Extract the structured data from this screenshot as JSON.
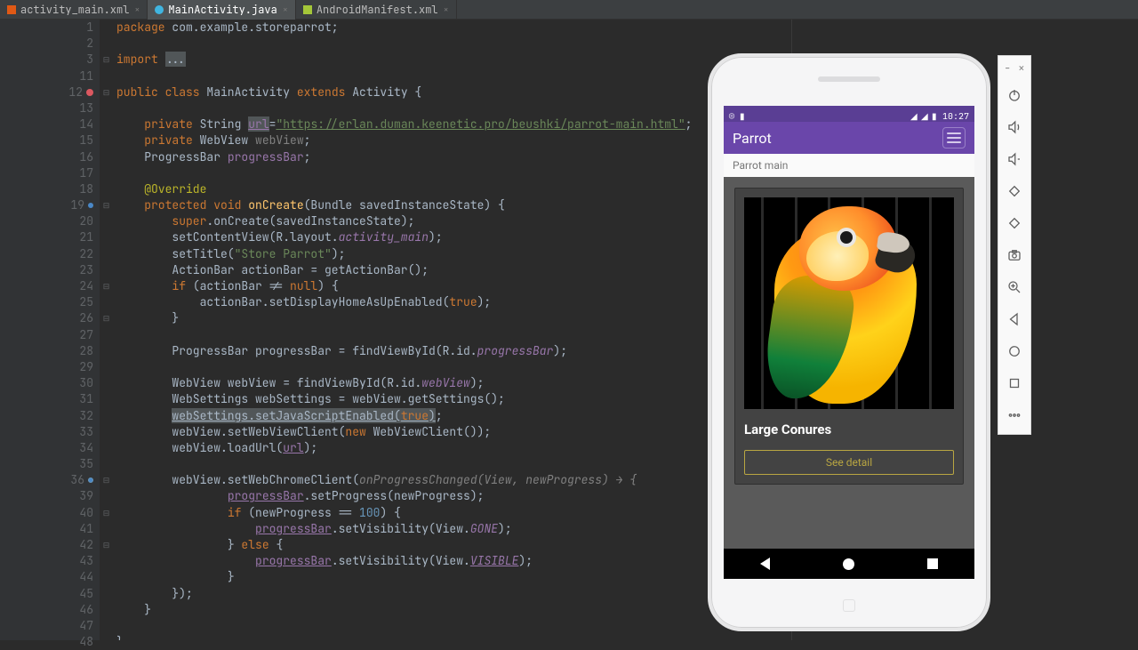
{
  "tabs": [
    {
      "label": "activity_main.xml",
      "icon": "xml",
      "active": false
    },
    {
      "label": "MainActivity.java",
      "icon": "java",
      "active": true
    },
    {
      "label": "AndroidManifest.xml",
      "icon": "manifest",
      "active": false
    }
  ],
  "gutter_lines": [
    "1",
    "2",
    "3",
    "11",
    "12",
    "13",
    "14",
    "15",
    "16",
    "17",
    "18",
    "19",
    "20",
    "21",
    "22",
    "23",
    "24",
    "25",
    "26",
    "27",
    "28",
    "29",
    "30",
    "31",
    "32",
    "33",
    "34",
    "35",
    "36",
    "39",
    "40",
    "41",
    "42",
    "43",
    "44",
    "45",
    "46",
    "47",
    "48"
  ],
  "code": {
    "l1_package": "package ",
    "l1_val": "com.example.storeparrot;",
    "l3_import": "import ",
    "l3_dots": "...",
    "l12": "public class MainActivity extends Activity {",
    "l14_kw": "private ",
    "l14_type": "String ",
    "l14_field": "url",
    "l14_eq": "=",
    "l14_str": "\"https://erlan.duman.keenetic.pro/beushki/parrot-main.html\"",
    "l14_end": ";",
    "l15": "private WebView webView;",
    "l16_a": "ProgressBar ",
    "l16_b": "progressBar",
    "l16_c": ";",
    "l18": "@Override",
    "l19": "protected void onCreate(Bundle savedInstanceState) {",
    "l20": "super.onCreate(savedInstanceState);",
    "l21_a": "setContentView(R.layout.",
    "l21_b": "activity_main",
    "l21_c": ");",
    "l22_a": "setTitle(",
    "l22_b": "\"Store Parrot\"",
    "l22_c": ");",
    "l23": "ActionBar actionBar = getActionBar();",
    "l24_a": "if (actionBar != ",
    "l24_b": "null",
    "l24_c": ") {",
    "l25_a": "actionBar.setDisplayHomeAsUpEnabled(",
    "l25_b": "true",
    "l25_c": ");",
    "l26": "}",
    "l28_a": "ProgressBar progressBar = findViewById(R.id.",
    "l28_b": "progressBar",
    "l28_c": ");",
    "l30_a": "WebView webView = findViewById(R.id.",
    "l30_b": "webView",
    "l30_c": ");",
    "l31": "WebSettings webSettings = webView.getSettings();",
    "l32_a": "webSettings.setJavaScriptEnabled(",
    "l32_b": "true",
    "l32_c": ");",
    "l33_a": "webView.setWebViewClient(",
    "l33_b": "new ",
    "l33_c": "WebViewClient());",
    "l34": "webView.loadUrl(url);",
    "l36_a": "webView.setWebChromeClient(",
    "l36_b": "onProgressChanged(View, newProgress) → {",
    "l39_a": "progressBar",
    "l39_b": ".setProgress(newProgress);",
    "l40_a": "if (newProgress == ",
    "l40_b": "100",
    "l40_c": ") {",
    "l41_a": "progressBar",
    "l41_b": ".setVisibility(View.",
    "l41_c": "GONE",
    "l41_d": ");",
    "l42_a": "} ",
    "l42_b": "else ",
    "l42_c": "{",
    "l43_a": "progressBar",
    "l43_b": ".setVisibility(View.",
    "l43_c": "VISIBLE",
    "l43_d": ");",
    "l44": "}",
    "l45": "});",
    "l46": "}",
    "l48": "}"
  },
  "emulator": {
    "time": "10:27",
    "app_title": "Parrot",
    "subtitle": "Parrot main",
    "card_title": "Large Conures",
    "button_label": "See detail"
  },
  "emu_toolbar": {
    "items": [
      "power",
      "volume-up",
      "volume-down",
      "rotate-left",
      "rotate-right",
      "camera",
      "zoom",
      "back",
      "home",
      "overview",
      "more"
    ]
  }
}
